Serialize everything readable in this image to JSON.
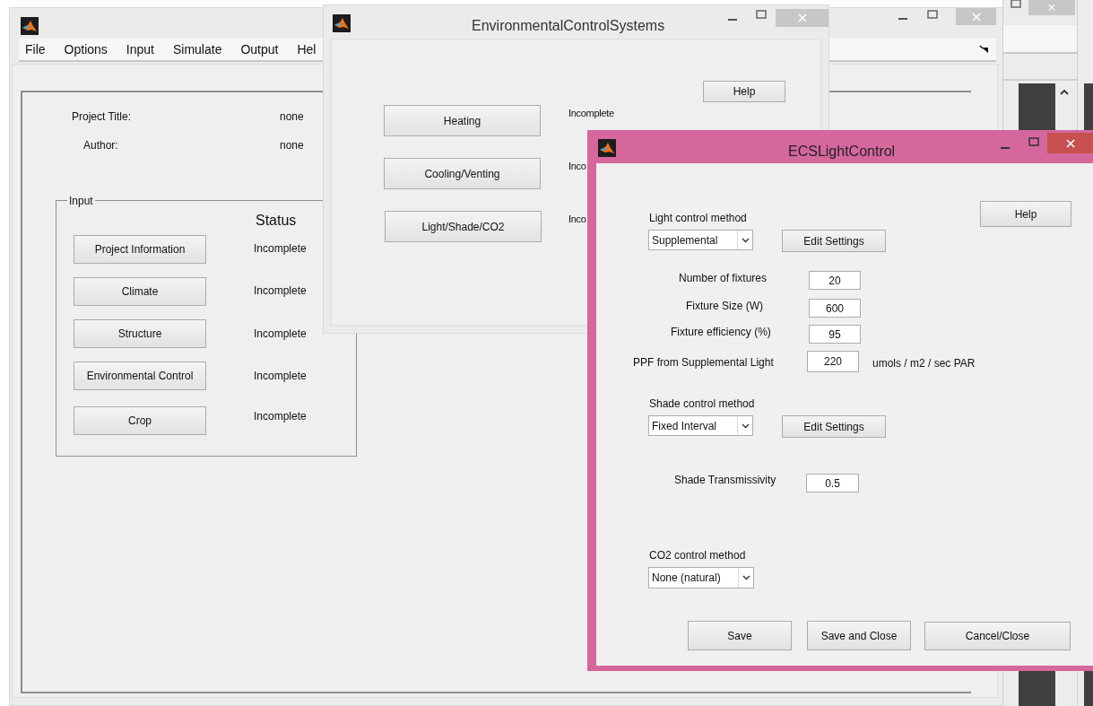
{
  "main_window": {
    "active": false,
    "menu": [
      "File",
      "Options",
      "Input",
      "Simulate",
      "Output",
      "Hel"
    ],
    "project_title_label": "Project Title:",
    "project_title_value": "none",
    "author_label": "Author:",
    "author_value": "none",
    "input_group": {
      "title": "Input",
      "status_heading": "Status",
      "items": [
        {
          "button": "Project Information",
          "status": "Incomplete"
        },
        {
          "button": "Climate",
          "status": "Incomplete"
        },
        {
          "button": "Structure",
          "status": "Incomplete"
        },
        {
          "button": "Environmental Control",
          "status": "Incomplete"
        },
        {
          "button": "Crop",
          "status": "Incomplete"
        }
      ]
    }
  },
  "env_window": {
    "title": "EnvironmentalControlSystems",
    "active": false,
    "help_button": "Help",
    "items": [
      {
        "button": "Heating",
        "status": "Incomplete"
      },
      {
        "button": "Cooling/Venting",
        "status": "Inco"
      },
      {
        "button": "Light/Shade/CO2",
        "status": "Inco"
      }
    ]
  },
  "light_window": {
    "title": "ECSLightControl",
    "active": true,
    "help_button": "Help",
    "light_method": {
      "label": "Light control method",
      "value": "Supplemental",
      "button": "Edit Settings"
    },
    "fields": [
      {
        "label": "Number of fixtures",
        "value": "20"
      },
      {
        "label": "Fixture Size (W)",
        "value": "600"
      },
      {
        "label": "Fixture efficiency (%)",
        "value": "95"
      },
      {
        "label": "PPF from Supplemental Light",
        "value": "220",
        "unit": "umols / m2 / sec PAR"
      }
    ],
    "shade_method": {
      "label": "Shade control method",
      "value": "Fixed Interval",
      "button": "Edit Settings"
    },
    "shade_transmissivity": {
      "label": "Shade Transmissivity",
      "value": "0.5"
    },
    "co2_method": {
      "label": "CO2 control method",
      "value": "None (natural)"
    },
    "buttons": [
      "Save",
      "Save and Close",
      "Cancel/Close"
    ]
  }
}
